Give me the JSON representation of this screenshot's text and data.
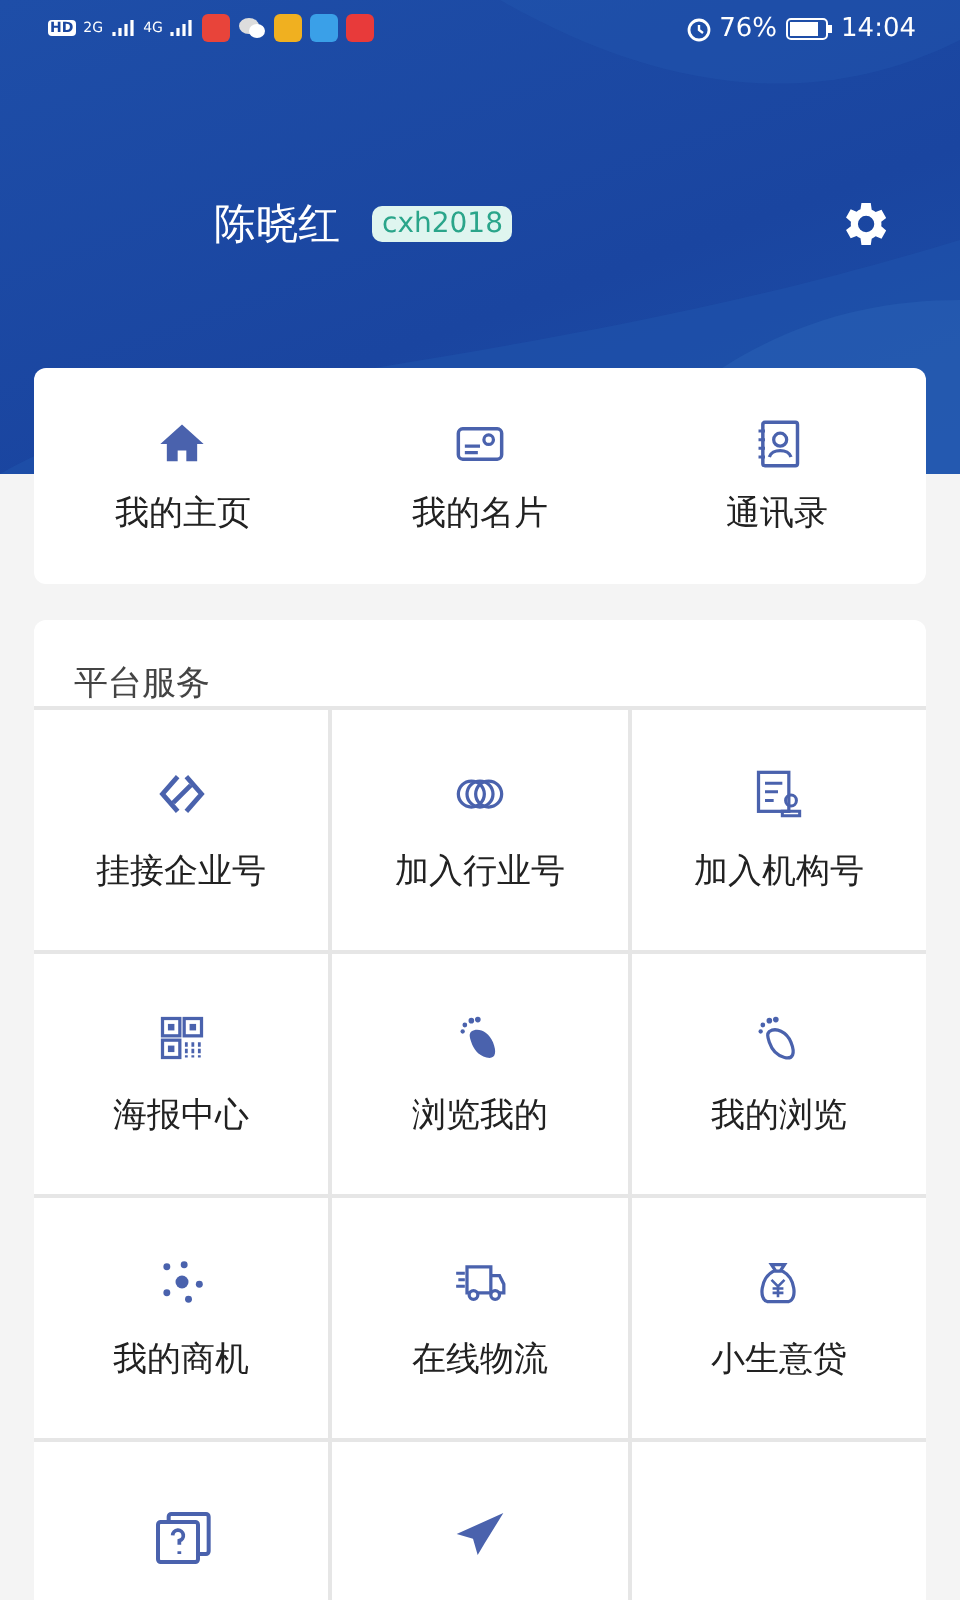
{
  "status_bar": {
    "hd": "HD",
    "networks": [
      "2G",
      "4G"
    ],
    "battery": "76%",
    "time": "14:04"
  },
  "profile": {
    "name": "陈晓红",
    "badge": "cxh2018"
  },
  "shortcuts": [
    {
      "label": "我的主页"
    },
    {
      "label": "我的名片"
    },
    {
      "label": "通讯录"
    }
  ],
  "services": {
    "title": "平台服务",
    "items": [
      {
        "kind": "full",
        "label": "挂接企业号"
      },
      {
        "kind": "full",
        "label": "加入行业号"
      },
      {
        "kind": "full",
        "label": "加入机构号"
      },
      {
        "kind": "full",
        "label": "海报中心"
      },
      {
        "kind": "full",
        "label": "浏览我的"
      },
      {
        "kind": "full",
        "label": "我的浏览"
      },
      {
        "kind": "full",
        "label": "我的商机"
      },
      {
        "kind": "full",
        "label": "在线物流"
      },
      {
        "kind": "full",
        "label": "小生意贷"
      },
      {
        "kind": "cut"
      },
      {
        "kind": "cut"
      },
      {
        "kind": "empty"
      }
    ]
  }
}
